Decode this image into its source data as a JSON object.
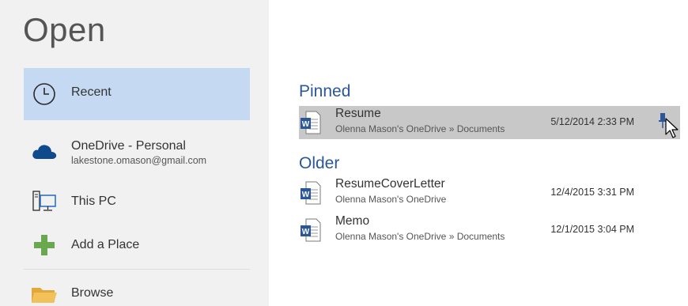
{
  "page": {
    "title": "Open"
  },
  "nav": {
    "recent": {
      "label": "Recent",
      "icon": "clock-icon"
    },
    "onedrive": {
      "label": "OneDrive - Personal",
      "sub": "lakestone.omason@gmail.com",
      "icon": "cloud-icon"
    },
    "this_pc": {
      "label": "This PC",
      "icon": "computer-icon"
    },
    "add_place": {
      "label": "Add a Place",
      "icon": "plus-icon"
    },
    "browse": {
      "label": "Browse",
      "icon": "folder-icon"
    }
  },
  "pinned": {
    "title": "Pinned",
    "files": [
      {
        "name": "Resume",
        "path": "Olenna Mason's OneDrive » Documents",
        "date": "5/12/2014 2:33 PM"
      }
    ]
  },
  "older": {
    "title": "Older",
    "files": [
      {
        "name": "ResumeCoverLetter",
        "path": "Olenna Mason's OneDrive",
        "date": "12/4/2015 3:31 PM"
      },
      {
        "name": "Memo",
        "path": "Olenna Mason's OneDrive » Documents",
        "date": "12/1/2015 3:04 PM"
      }
    ]
  },
  "colors": {
    "accent": "#2b579a",
    "selected": "#c5daf2",
    "hover": "#c8c8c8",
    "add_green": "#6aa84f"
  }
}
